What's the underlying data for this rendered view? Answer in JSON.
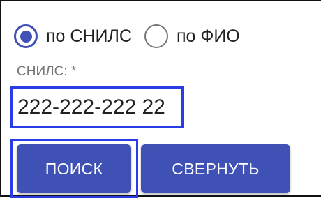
{
  "search_mode": {
    "options": [
      {
        "label": "по СНИЛС",
        "selected": true
      },
      {
        "label": "по ФИО",
        "selected": false
      }
    ]
  },
  "snils_field": {
    "label": "СНИЛС: *",
    "value": "222-222-222 22"
  },
  "buttons": {
    "search_label": "ПОИСК",
    "collapse_label": "СВЕРНУТЬ"
  },
  "colors": {
    "primary": "#3f51b5",
    "focus_outline": "#2a3ce8",
    "label_gray": "#757575"
  }
}
